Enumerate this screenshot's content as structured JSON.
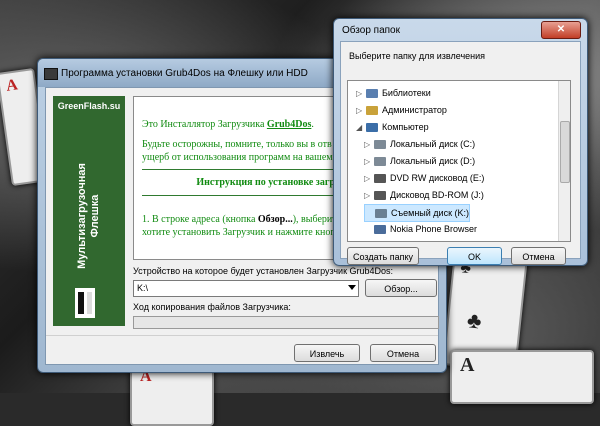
{
  "installer": {
    "title": "Программа установки Grub4Dos на Флешку или HDD",
    "sidebar": {
      "brand": "GreenFlash.su",
      "vertical_line1": "Мультизагрузочная",
      "vertical_line2": "Флешка"
    },
    "info": {
      "line1_prefix": "Это Инсталлятор Загрузчика ",
      "line1_link": "Grub4Dos",
      "line1_suffix": ".",
      "line2": "Будьте осторожны, помните, только вы в отв",
      "line3": "ущерб от использования программ на вашем",
      "heading": "Инструкция по установке загрузчика",
      "step1_prefix": "1. В строке адреса (кнопка ",
      "step1_bold": "Обзор...",
      "step1_suffix": "), выберит",
      "step1_line2": "хотите установить Загрузчик и нажмите кноп"
    },
    "device_label": "Устройство на которое будет установлен Загрузчик Grub4Dos:",
    "device_value": "K:\\",
    "browse_button": "Обзор...",
    "progress_label": "Ход копирования файлов Загрузчика:",
    "progress_value": 0,
    "extract_button": "Извлечь",
    "cancel_button": "Отмена"
  },
  "dialog": {
    "title": "Обзор папок",
    "close_label": "✕",
    "prompt": "Выберите папку для извлечения",
    "tree": [
      {
        "label": "Библиотеки",
        "icon": "libraries-icon",
        "color": "#5a7fb0"
      },
      {
        "label": "Администратор",
        "icon": "user-icon",
        "color": "#c9a23a"
      },
      {
        "label": "Компьютер",
        "icon": "computer-icon",
        "color": "#3b6ea8"
      },
      {
        "label": "Локальный диск (C:)",
        "icon": "drive-icon",
        "color": "#7d8a96"
      },
      {
        "label": "Локальный диск (D:)",
        "icon": "drive-icon",
        "color": "#7d8a96"
      },
      {
        "label": "DVD RW дисковод (E:)",
        "icon": "dvd-icon",
        "color": "#555555"
      },
      {
        "label": "Дисковод BD-ROM (J:)",
        "icon": "bd-icon",
        "color": "#555555"
      },
      {
        "label": "Съемный диск (K:)",
        "icon": "usb-drive-icon",
        "color": "#6a7f92"
      },
      {
        "label": "Nokia Phone Browser",
        "icon": "phone-icon",
        "color": "#4a6c9a"
      }
    ],
    "new_folder_button": "Создать папку",
    "ok_button": "OK",
    "cancel_button": "Отмена"
  }
}
